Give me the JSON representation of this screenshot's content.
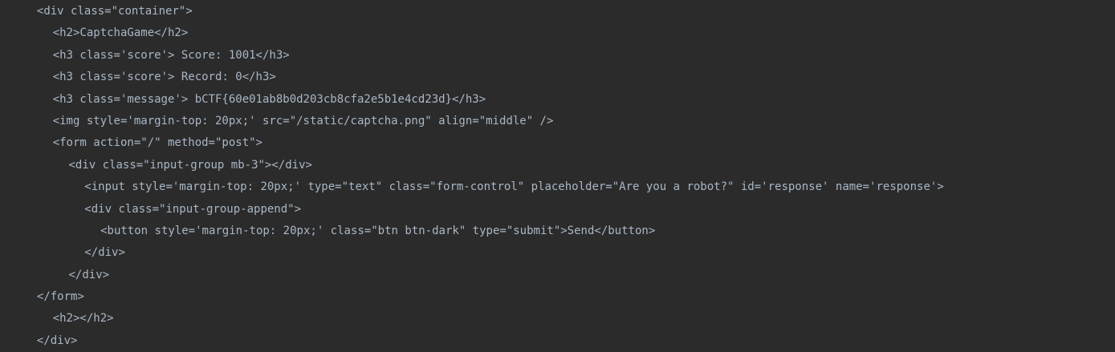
{
  "editor": {
    "lines": [
      {
        "indent": 2,
        "text": "<div class=\"container\">"
      },
      {
        "indent": 3,
        "text": "<h2>CaptchaGame</h2>"
      },
      {
        "indent": 3,
        "text": "<h3 class='score'> Score: 1001</h3>"
      },
      {
        "indent": 3,
        "text": "<h3 class='score'> Record: 0</h3>"
      },
      {
        "indent": 3,
        "text": "<h3 class='message'> bCTF{60e01ab8b0d203cb8cfa2e5b1e4cd23d}</h3>"
      },
      {
        "indent": 3,
        "text": "<img style='margin-top: 20px;' src=\"/static/captcha.png\" align=\"middle\" />"
      },
      {
        "indent": 3,
        "text": "<form action=\"/\" method=\"post\">"
      },
      {
        "indent": 4,
        "text": "<div class=\"input-group mb-3\"></div>"
      },
      {
        "indent": 5,
        "text": "<input style='margin-top: 20px;' type=\"text\" class=\"form-control\" placeholder=\"Are you a robot?\" id='response' name='response'>"
      },
      {
        "indent": 5,
        "text": "<div class=\"input-group-append\">"
      },
      {
        "indent": 6,
        "text": "<button style='margin-top: 20px;' class=\"btn btn-dark\" type=\"submit\">Send</button>"
      },
      {
        "indent": 5,
        "text": "</div>"
      },
      {
        "indent": 4,
        "text": "</div>"
      },
      {
        "indent": 2,
        "text": "</form>"
      },
      {
        "indent": 3,
        "text": "<h2></h2>"
      },
      {
        "indent": 2,
        "text": "</div>"
      }
    ]
  }
}
